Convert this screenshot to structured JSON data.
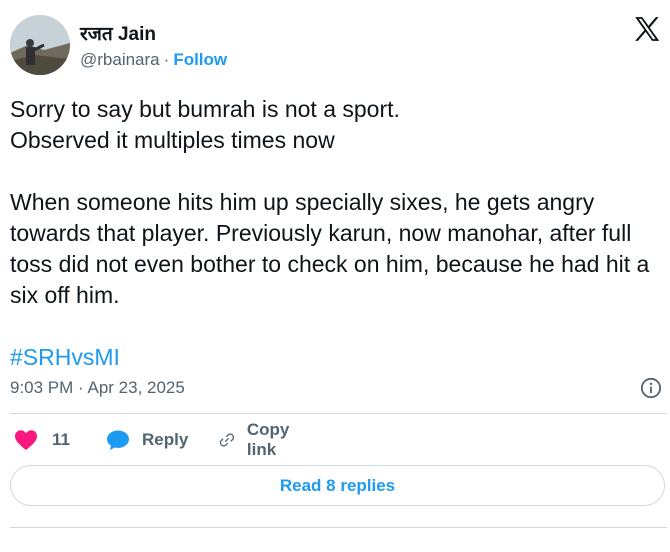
{
  "author": {
    "name": "रजत Jain",
    "handle": "@rbainara",
    "separator": "·",
    "follow_label": "Follow"
  },
  "brand_icon": "x-logo-icon",
  "post": {
    "lines": [
      "Sorry to say but bumrah is not a sport.",
      "Observed it multiples times now",
      "When someone hits him up specially sixes, he gets angry towards that player. Previously karun, now manohar, after full toss did not even bother to check on him, because he had hit a six off him."
    ],
    "hashtag": "#SRHvsMI"
  },
  "meta": {
    "timestamp": "9:03 PM · Apr 23, 2025",
    "info_icon": "info-icon"
  },
  "actions": {
    "like_count": "11",
    "reply_label": "Reply",
    "copy_link_label": "Copy link"
  },
  "read_replies_label": "Read 8 replies",
  "colors": {
    "accent": "#1d9bf0",
    "like": "#f91880",
    "text": "#0f1419",
    "secondary": "#536471",
    "border": "#cfd9de"
  }
}
